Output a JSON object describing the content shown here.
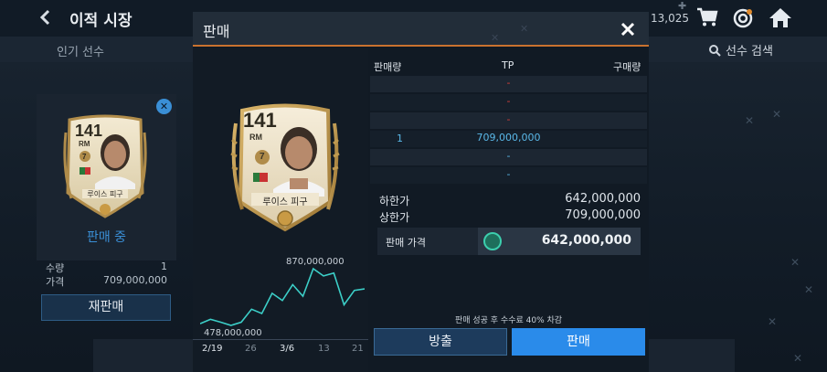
{
  "header": {
    "title": "이적 시장",
    "currency_amount": "13,025"
  },
  "tabs": {
    "popular": "인기 선수",
    "search": "선수 검색"
  },
  "listing": {
    "status": "판매 중",
    "qty_label": "수량",
    "qty_value": "1",
    "price_label": "가격",
    "price_value": "709,000,000",
    "resell_label": "재판매"
  },
  "player": {
    "rating": "141",
    "position": "RM",
    "level": "7",
    "name": "루이스 피구"
  },
  "modal": {
    "title": "판매",
    "table": {
      "col_sell_qty": "판매량",
      "col_tp": "TP",
      "col_buy_qty": "구매량",
      "rows": [
        {
          "qty": "",
          "tp": "-",
          "side": "sell"
        },
        {
          "qty": "",
          "tp": "-",
          "side": "sell"
        },
        {
          "qty": "",
          "tp": "-",
          "side": "sell"
        },
        {
          "qty": "1",
          "tp": "709,000,000",
          "side": "buy"
        },
        {
          "qty": "",
          "tp": "-",
          "side": "buy"
        },
        {
          "qty": "",
          "tp": "-",
          "side": "buy"
        }
      ]
    },
    "lower_limit_label": "하한가",
    "lower_limit_value": "642,000,000",
    "upper_limit_label": "상한가",
    "upper_limit_value": "709,000,000",
    "sale_price_label": "판매 가격",
    "sale_price_value": "642,000,000",
    "fee_note": "판매 성공 후 수수료 40% 차감",
    "release_label": "방출",
    "sell_label": "판매"
  },
  "price_graph": {
    "max_label": "870,000,000",
    "min_label": "478,000,000",
    "dates": [
      "2/19",
      "26",
      "3/6",
      "13",
      "21"
    ],
    "values": [
      490,
      520,
      500,
      478,
      500,
      590,
      560,
      700,
      650,
      760,
      680,
      870,
      820,
      840,
      620,
      720,
      730
    ]
  },
  "colors": {
    "accent_orange": "#c9722f",
    "sell_button": "#2a8bea",
    "line": "#3ccfc8",
    "tp_red": "#d9403a",
    "tp_blue": "#5ab8e8"
  }
}
